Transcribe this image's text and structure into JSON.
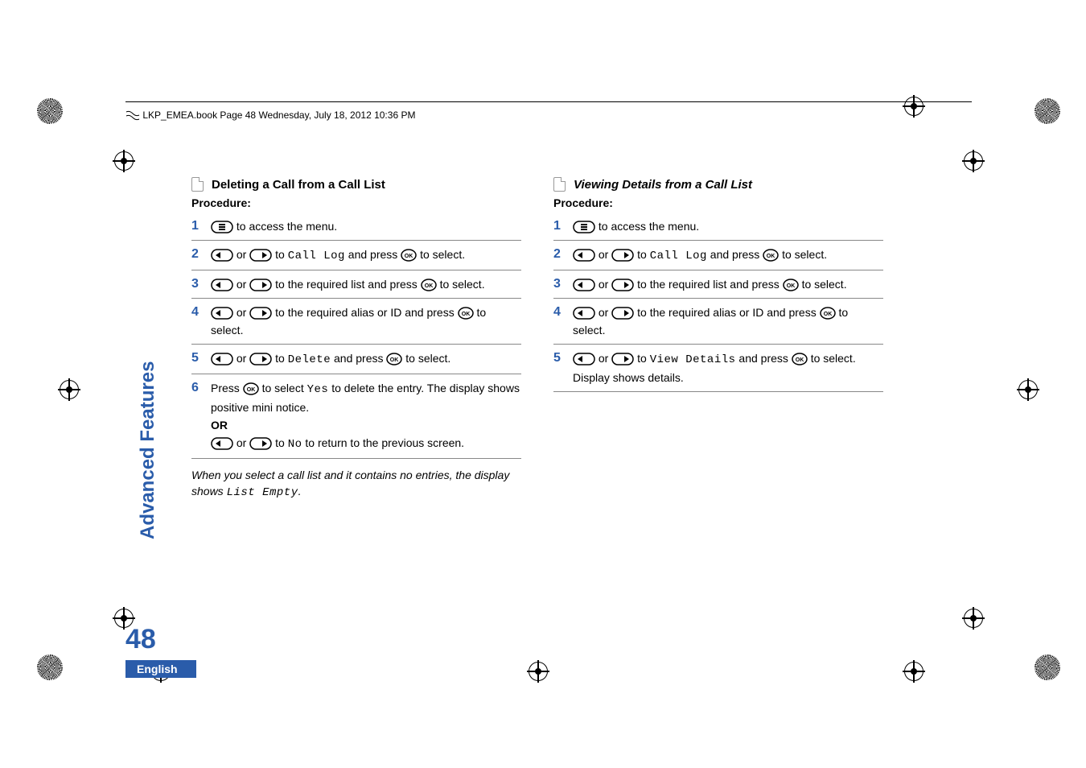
{
  "header": {
    "running_head": "LKP_EMEA.book  Page 48  Wednesday, July 18, 2012  10:36 PM"
  },
  "side_tab": "Advanced Features",
  "page_number": "48",
  "language": "English",
  "left": {
    "heading": "Deleting a Call from a Call List",
    "procedure_label": "Procedure:",
    "steps": {
      "s1": {
        "num": "1",
        "text_after_icon": " to access the menu."
      },
      "s2": {
        "num": "2",
        "or": " or ",
        "mid": " to ",
        "code": "Call Log",
        "after_code": " and press ",
        "tail": " to select."
      },
      "s3": {
        "num": "3",
        "or": " or ",
        "mid": " to the required list and press ",
        "tail": " to select."
      },
      "s4": {
        "num": "4",
        "or": " or ",
        "mid": " to the required alias or ID and press ",
        "tail": " to select."
      },
      "s5": {
        "num": "5",
        "or": " or ",
        "mid": " to ",
        "code": "Delete",
        "after_code": " and press ",
        "tail": " to select."
      },
      "s6": {
        "num": "6",
        "press": "Press ",
        "yes_sel": " to select ",
        "code_yes": "Yes",
        "yes_tail": " to delete the entry. The display shows positive mini notice.",
        "or_label": "OR",
        "or_between": " or ",
        "no_mid": " to ",
        "code_no": "No",
        "no_tail": " to return to the previous screen."
      }
    },
    "note": {
      "pre": "When you select a call list and it contains no entries, the display shows ",
      "code": "List Empty",
      "post": "."
    }
  },
  "right": {
    "heading": "Viewing Details from a Call List",
    "procedure_label": "Procedure:",
    "steps": {
      "s1": {
        "num": "1",
        "text_after_icon": " to access the menu."
      },
      "s2": {
        "num": "2",
        "or": " or ",
        "mid": " to ",
        "code": "Call Log",
        "after_code": " and press ",
        "tail": " to select."
      },
      "s3": {
        "num": "3",
        "or": " or ",
        "mid": " to the required list and press ",
        "tail": " to select."
      },
      "s4": {
        "num": "4",
        "or": " or ",
        "mid": " to the required alias or ID and press ",
        "tail": " to select."
      },
      "s5": {
        "num": "5",
        "or": " or ",
        "mid": " to ",
        "code": "View Details",
        "after_code": " and press ",
        "tail": " to select. Display shows details."
      }
    }
  }
}
